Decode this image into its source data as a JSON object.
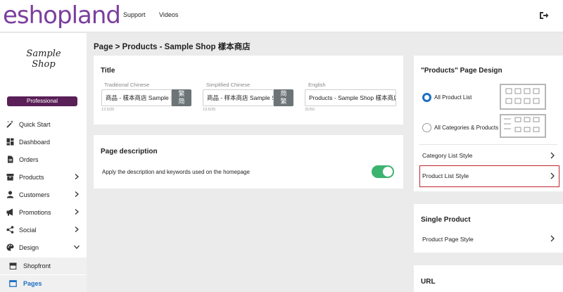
{
  "app": {
    "logo_text": "eshopland",
    "nav": [
      "Support",
      "Videos"
    ],
    "logout_icon": "sign-out-icon"
  },
  "sidebar": {
    "shop_logo": "Sample Shop",
    "plan": "Professional",
    "items": [
      {
        "label": "Quick Start",
        "icon": "magic-wand-icon",
        "has_chevron": false
      },
      {
        "label": "Dashboard",
        "icon": "dashboard-icon",
        "has_chevron": false
      },
      {
        "label": "Orders",
        "icon": "document-icon",
        "has_chevron": false
      },
      {
        "label": "Products",
        "icon": "box-icon",
        "has_chevron": true
      },
      {
        "label": "Customers",
        "icon": "user-icon",
        "has_chevron": true
      },
      {
        "label": "Promotions",
        "icon": "megaphone-icon",
        "has_chevron": true
      },
      {
        "label": "Social",
        "icon": "share-icon",
        "has_chevron": true
      },
      {
        "label": "Design",
        "icon": "palette-icon",
        "has_chevron": true,
        "expanded": true
      }
    ],
    "sub_items": [
      {
        "label": "Shopfront",
        "icon": "store-icon",
        "active": false
      },
      {
        "label": "Pages",
        "icon": "window-icon",
        "active": true
      }
    ]
  },
  "breadcrumb": "Page > Products - Sample Shop 樣本商店",
  "title_card": {
    "heading": "Title",
    "fields": [
      {
        "label": "Traditional Chinese",
        "value": "商品 - 樣本商店 Sample Shop",
        "counter": "13.5/25",
        "convert": [
          "繁",
          "简"
        ]
      },
      {
        "label": "Simplified Chinese",
        "value": "商品 - 样本商店 Sample Shop",
        "counter": "13.5/25",
        "convert": [
          "简",
          "繁"
        ]
      },
      {
        "label": "English",
        "value": "Products - Sample Shop 樣本商店",
        "counter": "31/50"
      }
    ]
  },
  "description_card": {
    "heading": "Page description",
    "toggle_label": "Apply the description and keywords used on the homepage",
    "toggle_on": true
  },
  "design_panel": {
    "heading": "\"Products\" Page Design",
    "options": [
      {
        "label": "All Product List",
        "selected": true
      },
      {
        "label": "All Categories & Products",
        "selected": false
      }
    ],
    "links": [
      "Category List Style",
      "Product List Style"
    ]
  },
  "single_product": {
    "heading": "Single Product",
    "links": [
      "Product Page Style"
    ]
  },
  "url_card": {
    "heading": "URL"
  },
  "colors": {
    "brand": "#7b3f9e",
    "badge": "#5a1f57",
    "toggle": "#3cb36f",
    "active_link": "#1d6fc4",
    "highlight": "#c0262d"
  }
}
